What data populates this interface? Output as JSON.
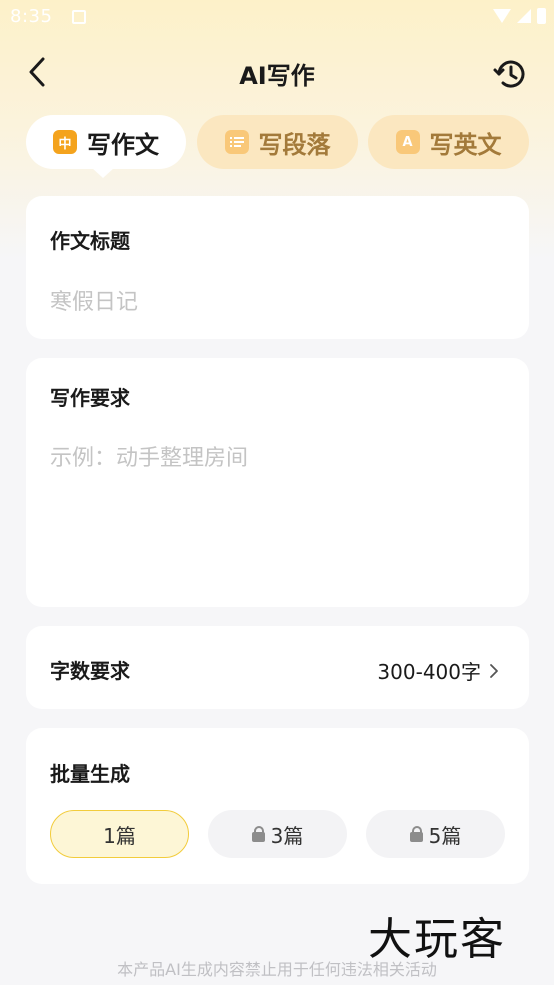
{
  "status_bar": {
    "time": "8:35"
  },
  "header": {
    "title": "AI写作"
  },
  "tabs": [
    {
      "label": "写作文",
      "icon_text": "中",
      "icon": "chinese-essay-icon"
    },
    {
      "label": "写段落",
      "icon": "paragraph-list-icon"
    },
    {
      "label": "写英文",
      "icon_text": "A",
      "icon": "english-icon"
    }
  ],
  "essay_title": {
    "label": "作文标题",
    "placeholder": "寒假日记"
  },
  "requirements": {
    "label": "写作要求",
    "placeholder": "示例：动手整理房间"
  },
  "word_count": {
    "label": "字数要求",
    "value": "300-400字"
  },
  "batch": {
    "label": "批量生成",
    "options": [
      {
        "label": "1篇",
        "selected": true,
        "locked": false
      },
      {
        "label": "3篇",
        "selected": false,
        "locked": true
      },
      {
        "label": "5篇",
        "selected": false,
        "locked": true
      }
    ]
  },
  "watermark": "大玩客",
  "footer": {
    "disclaimer": "本产品AI生成内容禁止用于任何违法相关活动"
  },
  "colors": {
    "accent": "#f4a31d",
    "selected_border": "#f2cc3c",
    "tab_inactive_bg": "#fbe7c0"
  }
}
